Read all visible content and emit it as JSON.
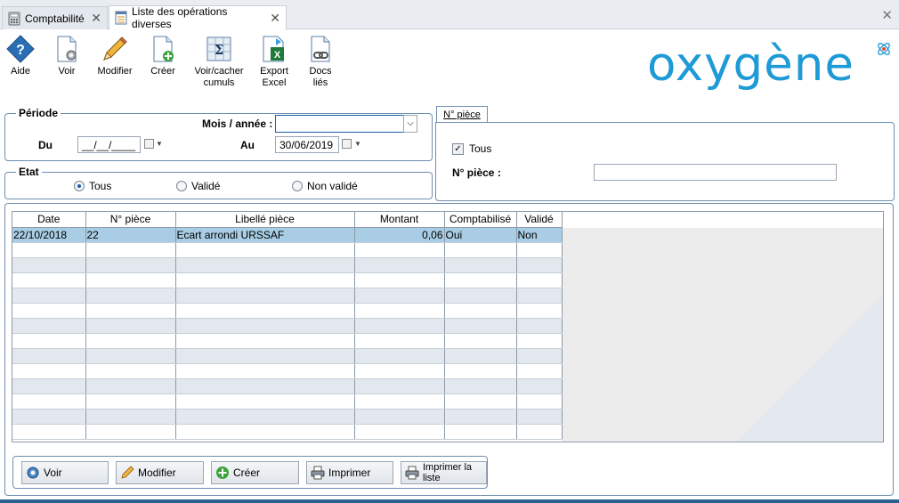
{
  "tabs": [
    {
      "label": "Comptabilité",
      "active": false
    },
    {
      "label": "Liste des opérations diverses",
      "active": true
    }
  ],
  "toolbar": {
    "items": [
      {
        "label": "Aide",
        "icon": "help-icon"
      },
      {
        "label": "Voir",
        "icon": "view-document-icon"
      },
      {
        "label": "Modifier",
        "icon": "pencil-icon"
      },
      {
        "label": "Créer",
        "icon": "new-document-icon"
      },
      {
        "label": "Voir/cacher\ncumuls",
        "icon": "sigma-icon"
      },
      {
        "label": "Export\nExcel",
        "icon": "excel-export-icon"
      },
      {
        "label": "Docs\nliés",
        "icon": "linked-docs-icon"
      }
    ]
  },
  "brand": {
    "logo_text": "oxygène",
    "color": "#1e9ad6"
  },
  "periode": {
    "title": "Période",
    "mois_annee_label": "Mois / année :",
    "mois_annee_value": "",
    "du_label": "Du",
    "du_value": "__/__/____",
    "au_label": "Au",
    "au_value": "30/06/2019"
  },
  "etat": {
    "title": "Etat",
    "options": [
      "Tous",
      "Validé",
      "Non validé"
    ],
    "selected": "Tous"
  },
  "piece_filter": {
    "tab_label": "N° pièce",
    "tous_label": "Tous",
    "tous_checked": true,
    "piece_label": "N° pièce :",
    "piece_value": ""
  },
  "grid": {
    "columns": [
      "Date",
      "N° pièce",
      "Libellé pièce",
      "Montant",
      "Comptabilisé",
      "Validé"
    ],
    "rows": [
      [
        "22/10/2018",
        "22",
        "Ecart arrondi URSSAF",
        "0,06",
        "Oui",
        "Non"
      ]
    ],
    "empty_rows": 13,
    "selection_color": "#a8cde4"
  },
  "actions": {
    "voir": "Voir",
    "modifier": "Modifier",
    "creer": "Créer",
    "imprimer": "Imprimer",
    "imprimer_liste": "Imprimer la liste"
  }
}
